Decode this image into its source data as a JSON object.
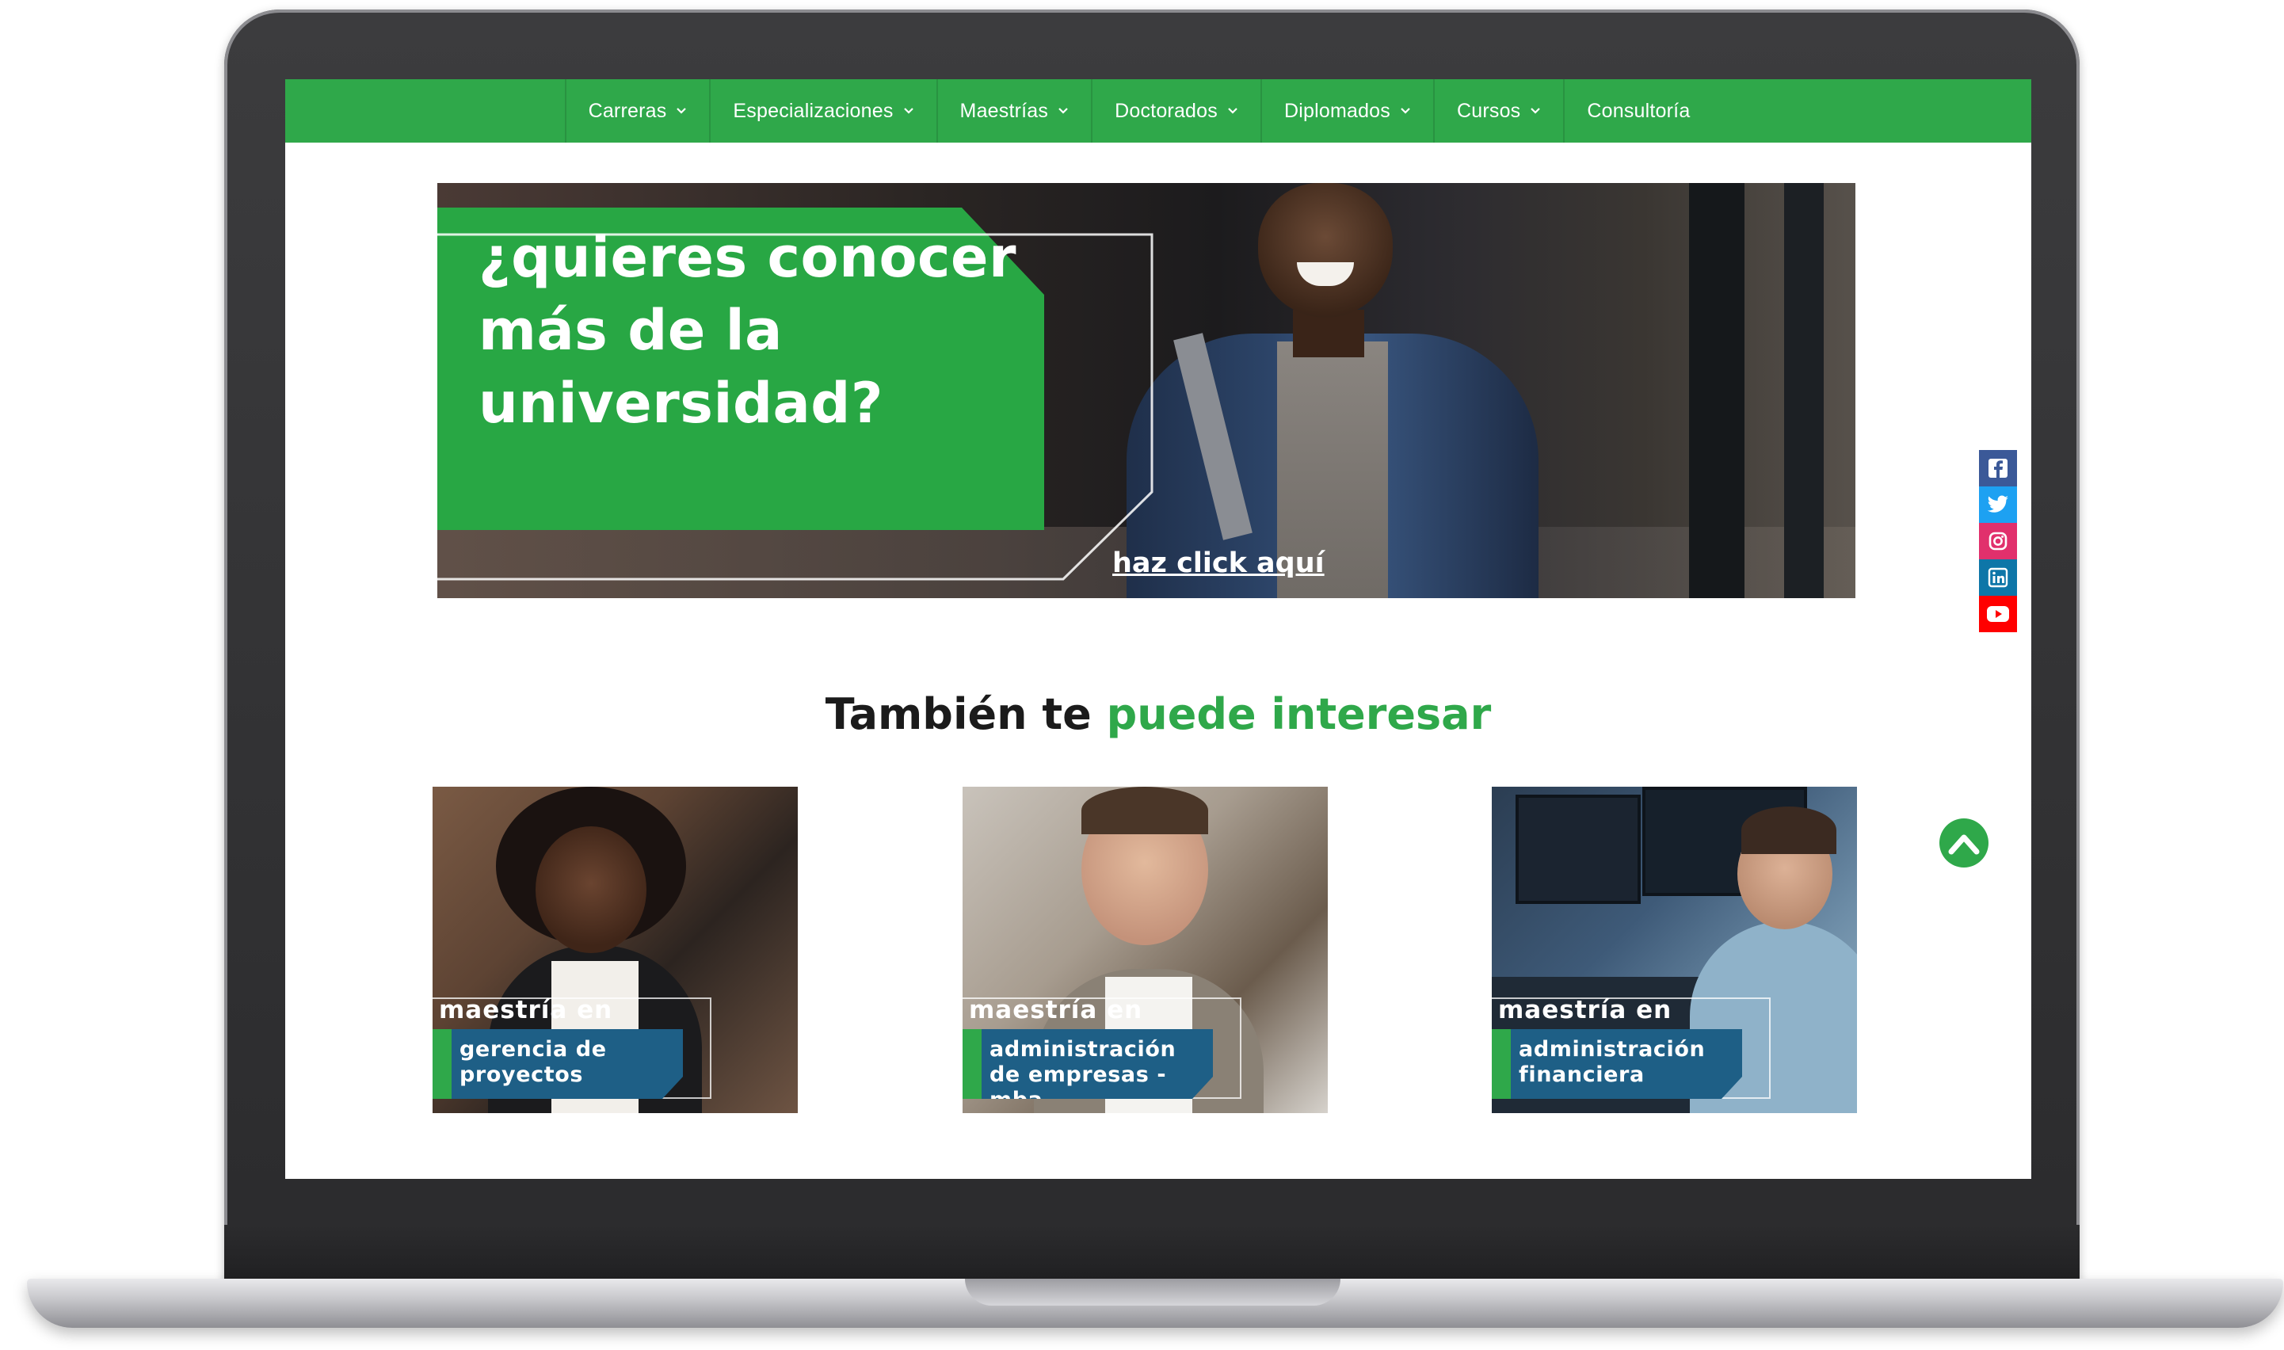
{
  "nav": {
    "items": [
      {
        "label": "Carreras",
        "has_dropdown": true
      },
      {
        "label": "Especializaciones",
        "has_dropdown": true
      },
      {
        "label": "Maestrías",
        "has_dropdown": true
      },
      {
        "label": "Doctorados",
        "has_dropdown": true
      },
      {
        "label": "Diplomados",
        "has_dropdown": true
      },
      {
        "label": "Cursos",
        "has_dropdown": true
      },
      {
        "label": "Consultoría",
        "has_dropdown": false
      }
    ]
  },
  "hero": {
    "headline": "¿quieres conocer más de la universidad?",
    "cta": "haz click aquí"
  },
  "social": [
    {
      "icon": "facebook-icon",
      "color": "#3b5998"
    },
    {
      "icon": "twitter-icon",
      "color": "#1da1f2"
    },
    {
      "icon": "instagram-icon",
      "color": "#e1306c"
    },
    {
      "icon": "linkedin-icon",
      "color": "#0e76a8"
    },
    {
      "icon": "youtube-icon",
      "color": "#ff0000"
    }
  ],
  "section": {
    "title_plain": "También te",
    "title_accent": "puede interesar"
  },
  "cards": [
    {
      "prefix": "maestría en",
      "title": "gerencia de proyectos"
    },
    {
      "prefix": "maestría en",
      "title": "administración de empresas - mba"
    },
    {
      "prefix": "maestría en",
      "title": "administración financiera"
    }
  ],
  "colors": {
    "brand_green": "#2fa84a",
    "label_blue": "#1e5f86"
  }
}
